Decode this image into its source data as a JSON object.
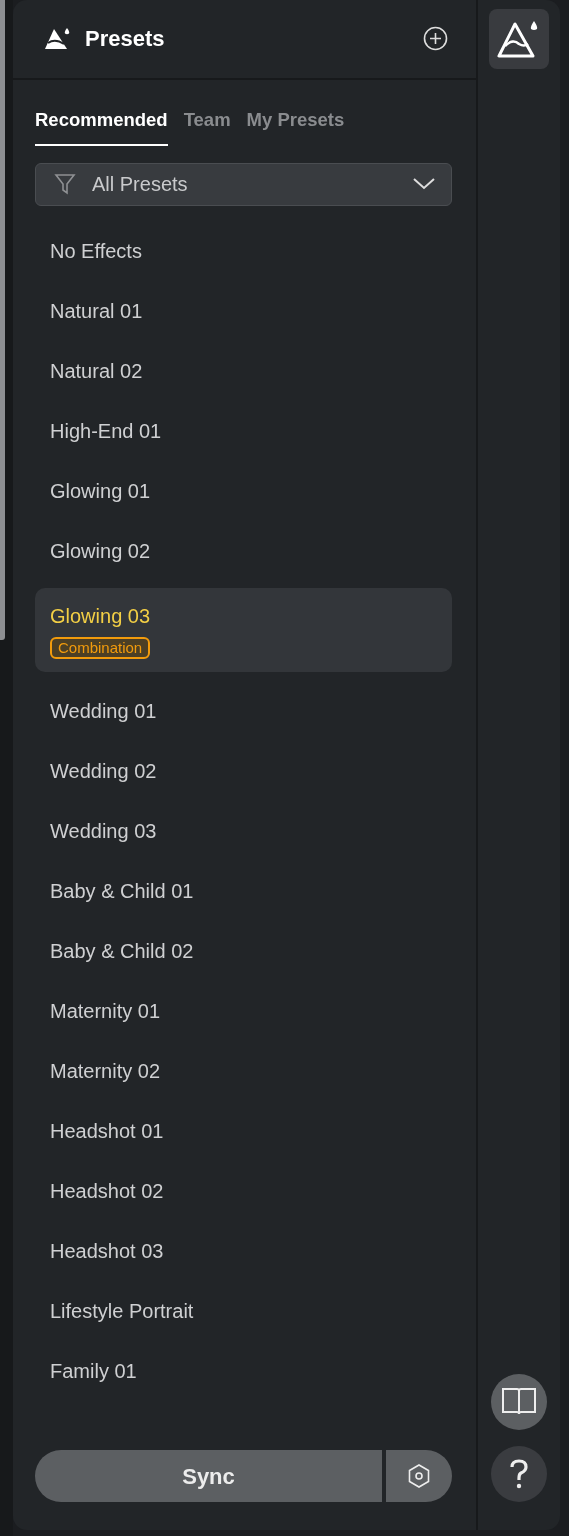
{
  "panel": {
    "title": "Presets"
  },
  "tabs": [
    {
      "label": "Recommended",
      "selected": true
    },
    {
      "label": "Team",
      "selected": false
    },
    {
      "label": "My Presets",
      "selected": false
    }
  ],
  "filter": {
    "value": "All Presets"
  },
  "presets": [
    {
      "name": "No Effects",
      "selected": false
    },
    {
      "name": "Natural 01",
      "selected": false
    },
    {
      "name": "Natural 02",
      "selected": false
    },
    {
      "name": "High-End 01",
      "selected": false
    },
    {
      "name": "Glowing 01",
      "selected": false
    },
    {
      "name": "Glowing 02",
      "selected": false
    },
    {
      "name": "Glowing 03",
      "selected": true,
      "tag": "Combination"
    },
    {
      "name": "Wedding 01",
      "selected": false
    },
    {
      "name": "Wedding 02",
      "selected": false
    },
    {
      "name": "Wedding 03",
      "selected": false
    },
    {
      "name": "Baby & Child 01",
      "selected": false
    },
    {
      "name": "Baby & Child 02",
      "selected": false
    },
    {
      "name": "Maternity 01",
      "selected": false
    },
    {
      "name": "Maternity 02",
      "selected": false
    },
    {
      "name": "Headshot 01",
      "selected": false
    },
    {
      "name": "Headshot 02",
      "selected": false
    },
    {
      "name": "Headshot 03",
      "selected": false
    },
    {
      "name": "Lifestyle Portrait",
      "selected": false
    },
    {
      "name": "Family 01",
      "selected": false
    }
  ],
  "footer": {
    "button": "Sync"
  }
}
